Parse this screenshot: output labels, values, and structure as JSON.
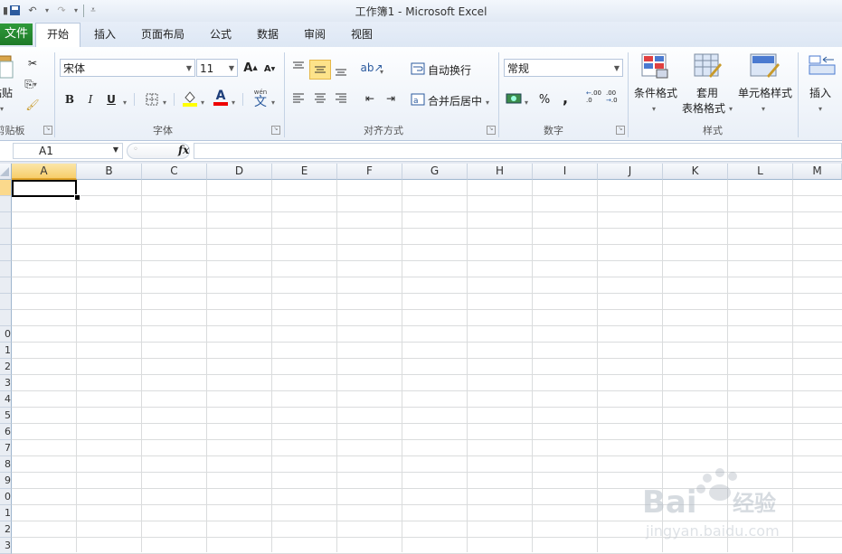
{
  "window": {
    "title": "工作簿1 - Microsoft Excel"
  },
  "qat": {
    "save_icon": "save-icon",
    "undo_icon": "undo-icon",
    "redo_icon": "redo-icon",
    "customize_icon": "customize-icon"
  },
  "tabs": [
    {
      "label": "文件"
    },
    {
      "label": "开始"
    },
    {
      "label": "插入"
    },
    {
      "label": "页面布局"
    },
    {
      "label": "公式"
    },
    {
      "label": "数据"
    },
    {
      "label": "审阅"
    },
    {
      "label": "视图"
    }
  ],
  "ribbon": {
    "clipboard": {
      "paste_label": "粘贴",
      "group_label": "剪贴板"
    },
    "font": {
      "font_name": "宋体",
      "font_size": "11",
      "bold": "B",
      "italic": "I",
      "underline": "U",
      "font_color_label": "A",
      "phonetic": "wén",
      "group_label": "字体"
    },
    "alignment": {
      "wrap_text": "自动换行",
      "merge_center": "合并后居中",
      "group_label": "对齐方式"
    },
    "number": {
      "format": "常规",
      "percent": "%",
      "comma": ",",
      "inc_decimal": ".00",
      "dec_decimal": ".00",
      "group_label": "数字"
    },
    "styles": {
      "conditional": "条件格式",
      "table_format_line1": "套用",
      "table_format_line2": "表格格式",
      "cell_styles": "单元格样式",
      "group_label": "样式"
    },
    "cells": {
      "insert": "插入"
    }
  },
  "formula_bar": {
    "name_box": "A1",
    "fx": "fx",
    "value": ""
  },
  "grid": {
    "columns": [
      "A",
      "B",
      "C",
      "D",
      "E",
      "F",
      "G",
      "H",
      "I",
      "J",
      "K",
      "L",
      "M"
    ],
    "rows": [
      "",
      "",
      "",
      "",
      "",
      "",
      "",
      "",
      "",
      "0",
      "1",
      "2",
      "3",
      "4",
      "5",
      "6",
      "7",
      "8",
      "9",
      "0",
      "1",
      "2",
      "3"
    ],
    "active_cell": "A1"
  },
  "colors": {
    "accent_green": "#1d7a28",
    "ribbon_blue": "#dde7f4",
    "active_header": "#f7ce6b"
  }
}
